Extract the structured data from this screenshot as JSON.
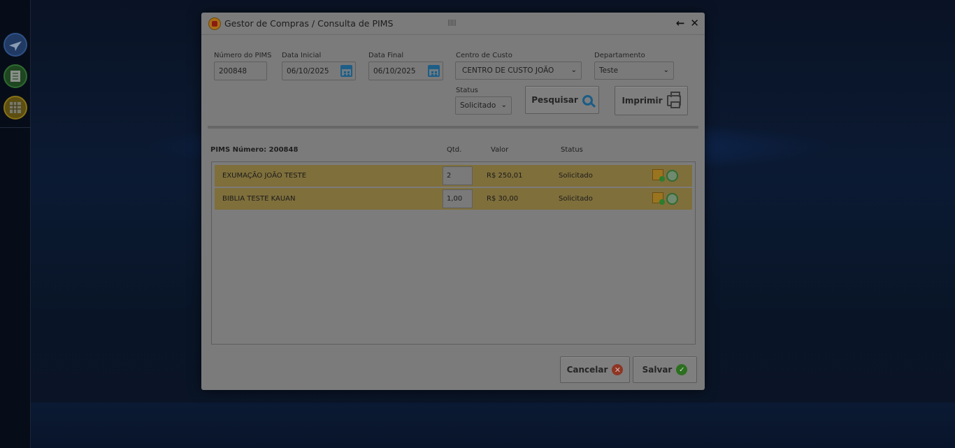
{
  "dialog": {
    "title": "Gestor de Compras / Consulta de PIMS",
    "back_icon": "←",
    "close_icon": "✕"
  },
  "filters": {
    "numero_label": "Número do PIMS",
    "numero_value": "200848",
    "data_inicial_label": "Data Inicial",
    "data_inicial_value": "06/10/2025",
    "data_final_label": "Data Final",
    "data_final_value": "06/10/2025",
    "centro_label": "Centro de Custo",
    "centro_value": "CENTRO DE CUSTO JOÃO",
    "departamento_label": "Departamento",
    "departamento_value": "Teste",
    "status_label": "Status",
    "status_value": "Solicitado"
  },
  "actions": {
    "pesquisar_label": "Pesquisar",
    "imprimir_label": "Imprimir",
    "cancelar_label": "Cancelar",
    "salvar_label": "Salvar"
  },
  "table": {
    "pims_label": "PIMS Número: 200848",
    "headers": [
      "Qtd.",
      "Valor",
      "Status"
    ],
    "rows": [
      {
        "descricao": "EXUMAÇÃO JOÃO TESTE",
        "qtd": "2",
        "valor": "R$ 250,01",
        "status": "Solicitado"
      },
      {
        "descricao": "BIBLIA TESTE KAUAN",
        "qtd": "1,00",
        "valor": "R$ 30,00",
        "status": "Solicitado"
      }
    ]
  },
  "icons": {
    "rail": [
      "airplane-icon",
      "spreadsheet-icon",
      "grid-icon"
    ],
    "row": [
      "note-add-icon",
      "clock-icon"
    ]
  },
  "colors": {
    "row_highlight": "#7f6f3b",
    "dialog_bg": "#7b7b7b",
    "desktop_bg": "#0b1322"
  }
}
